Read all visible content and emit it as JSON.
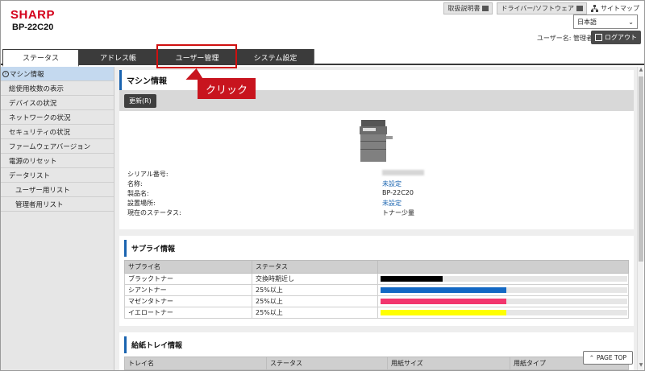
{
  "header": {
    "logo": "SHARP",
    "model": "BP-22C20",
    "links": [
      "取扱説明書",
      "ドライバー/ソフトウェア"
    ],
    "sitemap": "サイトマップ",
    "language": "日本語",
    "user_label": "ユーザー名: 管理者",
    "logout": "ログアウト"
  },
  "tabs": [
    {
      "label": "ステータス"
    },
    {
      "label": "アドレス帳"
    },
    {
      "label": "ユーザー管理"
    },
    {
      "label": "システム設定"
    }
  ],
  "callout": "クリック",
  "sidebar": {
    "items": [
      "マシン情報",
      "総使用枚数の表示",
      "デバイスの状況",
      "ネットワークの状況",
      "セキュリティの状況",
      "ファームウェアバージョン",
      "電源のリセット",
      "データリスト",
      "ユーザー用リスト",
      "管理者用リスト"
    ]
  },
  "machine": {
    "title": "マシン情報",
    "refresh": "更新(R)",
    "rows": [
      {
        "label": "シリアル番号:",
        "value": ""
      },
      {
        "label": "名称:",
        "value": "未設定"
      },
      {
        "label": "製品名:",
        "value": "BP-22C20"
      },
      {
        "label": "設置場所:",
        "value": "未設定"
      },
      {
        "label": "現在のステータス:",
        "value": "トナー少量"
      }
    ]
  },
  "supply": {
    "title": "サプライ情報",
    "headers": [
      "サプライ名",
      "ステータス"
    ],
    "rows": [
      {
        "name": "ブラックトナー",
        "status": "交換時期近し",
        "level": 0.25,
        "color": "#000000"
      },
      {
        "name": "シアントナー",
        "status": "25%以上",
        "level": 0.51,
        "color": "#1368c4"
      },
      {
        "name": "マゼンタトナー",
        "status": "25%以上",
        "level": 0.51,
        "color": "#f2366e"
      },
      {
        "name": "イエロートナー",
        "status": "25%以上",
        "level": 0.51,
        "color": "#ffff00"
      }
    ]
  },
  "tray": {
    "title": "給紙トレイ情報",
    "headers": [
      "トレイ名",
      "ステータス",
      "用紙サイズ",
      "用紙タイプ"
    ]
  },
  "pagetop": "PAGE TOP"
}
